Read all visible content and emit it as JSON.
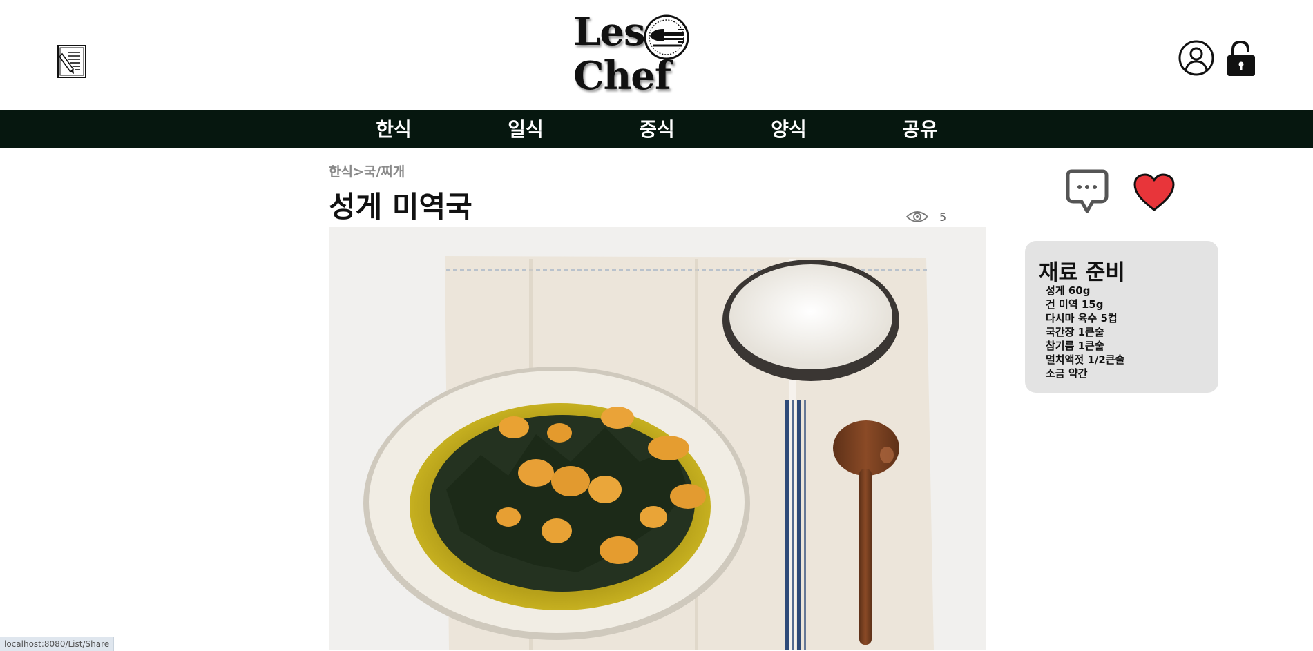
{
  "logo": {
    "line1": "Les",
    "line2": "Chef"
  },
  "nav": {
    "items": [
      "한식",
      "일식",
      "중식",
      "양식",
      "공유"
    ]
  },
  "breadcrumb": {
    "category": "한식",
    "separator": ">",
    "subcategory": "국/찌개"
  },
  "recipe": {
    "title": "성게 미역국",
    "views": "5"
  },
  "ingredients": {
    "heading": "재료 준비",
    "items": [
      "성게 60g",
      "건 미역 15g",
      "다시마 육수 5컵",
      "국간장 1큰술",
      "참기름 1큰술",
      "멸치액젓 1/2큰술",
      "소금 약간"
    ]
  },
  "status_bar": {
    "url": "localhost:8080/List/Share"
  },
  "colors": {
    "nav_bg": "#06170f",
    "heart": "#e8353a",
    "ingredients_bg": "#e3e3e3",
    "breadcrumb": "#8a8a8a"
  },
  "icons": [
    "write-recipe-icon",
    "logo-plate-icon",
    "user-icon",
    "unlock-icon",
    "eye-icon",
    "comment-icon",
    "heart-icon"
  ]
}
